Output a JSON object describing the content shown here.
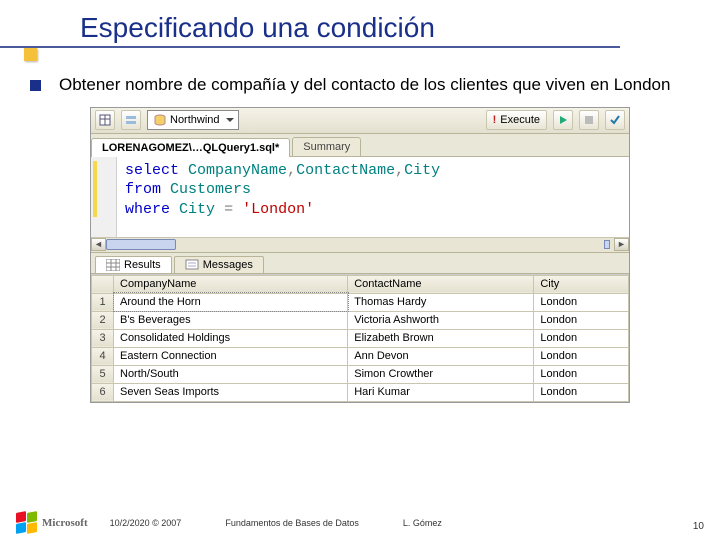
{
  "slide": {
    "title": "Especificando una condición",
    "bullet": "Obtener nombre de compañía y del contacto de los clientes que viven en London"
  },
  "toolbar": {
    "database": "Northwind",
    "execute_label": "Execute"
  },
  "tabs": {
    "query_tab": "LORENAGOMEZ\\…QLQuery1.sql*",
    "summary_tab": "Summary"
  },
  "sql": {
    "select_kw": "select",
    "cols_1": "CompanyName",
    "cols_2": "ContactName",
    "cols_3": "City",
    "from_kw": "from",
    "table": "Customers",
    "where_kw": "where",
    "where_col": "City",
    "eq": "=",
    "where_val": "'London'"
  },
  "results": {
    "tab_results": "Results",
    "tab_messages": "Messages",
    "headers": {
      "c1": "CompanyName",
      "c2": "ContactName",
      "c3": "City"
    },
    "rows": [
      {
        "n": "1",
        "company": "Around the Horn",
        "contact": "Thomas Hardy",
        "city": "London"
      },
      {
        "n": "2",
        "company": "B's Beverages",
        "contact": "Victoria Ashworth",
        "city": "London"
      },
      {
        "n": "3",
        "company": "Consolidated Holdings",
        "contact": "Elizabeth Brown",
        "city": "London"
      },
      {
        "n": "4",
        "company": "Eastern Connection",
        "contact": "Ann Devon",
        "city": "London"
      },
      {
        "n": "5",
        "company": "North/South",
        "contact": "Simon Crowther",
        "city": "London"
      },
      {
        "n": "6",
        "company": "Seven Seas Imports",
        "contact": "Hari Kumar",
        "city": "London"
      }
    ]
  },
  "footer": {
    "brand": "Microsoft",
    "date": "10/2/2020 © 2007",
    "center": "Fundamentos de Bases de Datos",
    "author": "L. Gómez",
    "slide_no": "10"
  }
}
